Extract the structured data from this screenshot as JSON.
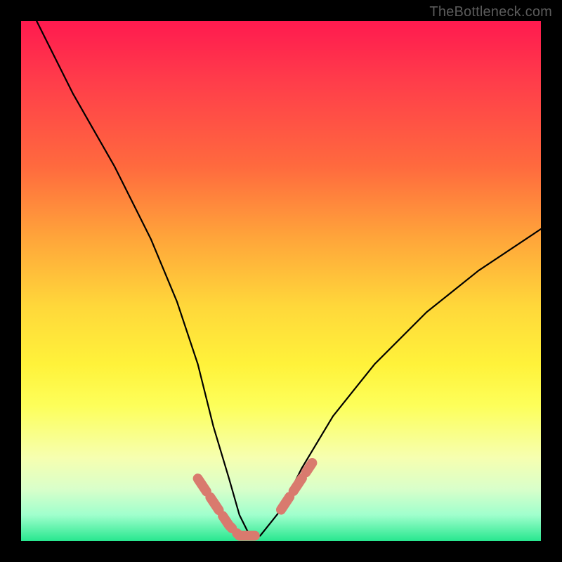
{
  "watermark": {
    "text": "TheBottleneck.com"
  },
  "chart_data": {
    "type": "line",
    "title": "",
    "xlabel": "",
    "ylabel": "",
    "xlim": [
      0,
      100
    ],
    "ylim": [
      0,
      100
    ],
    "grid": false,
    "legend": false,
    "series": [
      {
        "name": "bottleneck-curve",
        "x": [
          3,
          10,
          18,
          25,
          30,
          34,
          37,
          40,
          42,
          44,
          46,
          50,
          54,
          60,
          68,
          78,
          88,
          100
        ],
        "values": [
          100,
          86,
          72,
          58,
          46,
          34,
          22,
          12,
          5,
          1,
          1,
          6,
          14,
          24,
          34,
          44,
          52,
          60
        ]
      }
    ],
    "highlighted_segments": [
      {
        "name": "left-descent-markers",
        "x": [
          34,
          36,
          38,
          40,
          42
        ],
        "values": [
          12,
          9,
          6,
          3,
          1
        ]
      },
      {
        "name": "valley-floor",
        "x": [
          42,
          44,
          46
        ],
        "values": [
          1,
          1,
          1
        ]
      },
      {
        "name": "right-ascent-markers",
        "x": [
          50,
          52,
          54,
          56
        ],
        "values": [
          6,
          9,
          12,
          15
        ]
      }
    ],
    "background_gradient": {
      "stops": [
        {
          "pos": 0,
          "color": "#ff1a4f"
        },
        {
          "pos": 28,
          "color": "#ff6a3e"
        },
        {
          "pos": 55,
          "color": "#ffd83a"
        },
        {
          "pos": 84,
          "color": "#f6ffb0"
        },
        {
          "pos": 100,
          "color": "#28e78f"
        }
      ]
    }
  }
}
